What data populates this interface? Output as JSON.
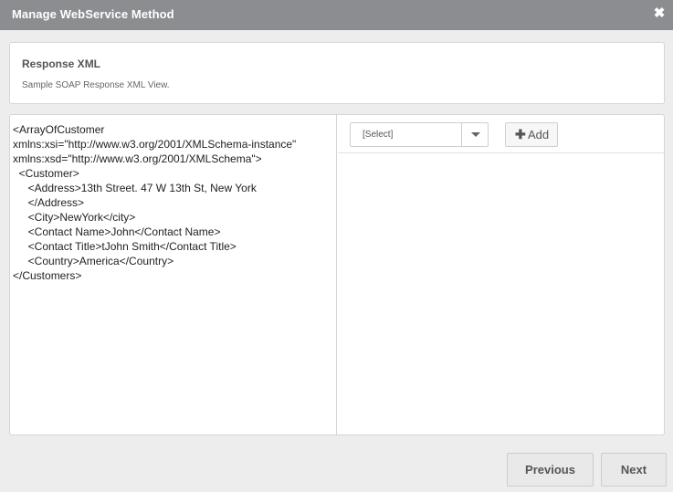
{
  "dialog": {
    "title": "Manage WebService Method",
    "close_symbol": "✖"
  },
  "info": {
    "heading": "Response XML",
    "description": "Sample SOAP Response XML View."
  },
  "xml": {
    "lines": [
      "<ArrayOfCustomer",
      "xmlns:xsi=\"http://www.w3.org/2001/XMLSchema-instance\"",
      "xmlns:xsd=\"http://www.w3.org/2001/XMLSchema\">",
      "  <Customer>",
      "     <Address>13th Street. 47 W 13th St, New York",
      "     </Address>",
      "     <City>NewYork</city>",
      "     <Contact Name>John</Contact Name>",
      "     <Contact Title>tJohn Smith</Contact Title>",
      "     <Country>America</Country>",
      "</Customers>"
    ]
  },
  "mapping": {
    "select_value": "[Select]",
    "add_symbol": "✚",
    "add_label": "Add"
  },
  "footer": {
    "previous_label": "Previous",
    "next_label": "Next"
  }
}
